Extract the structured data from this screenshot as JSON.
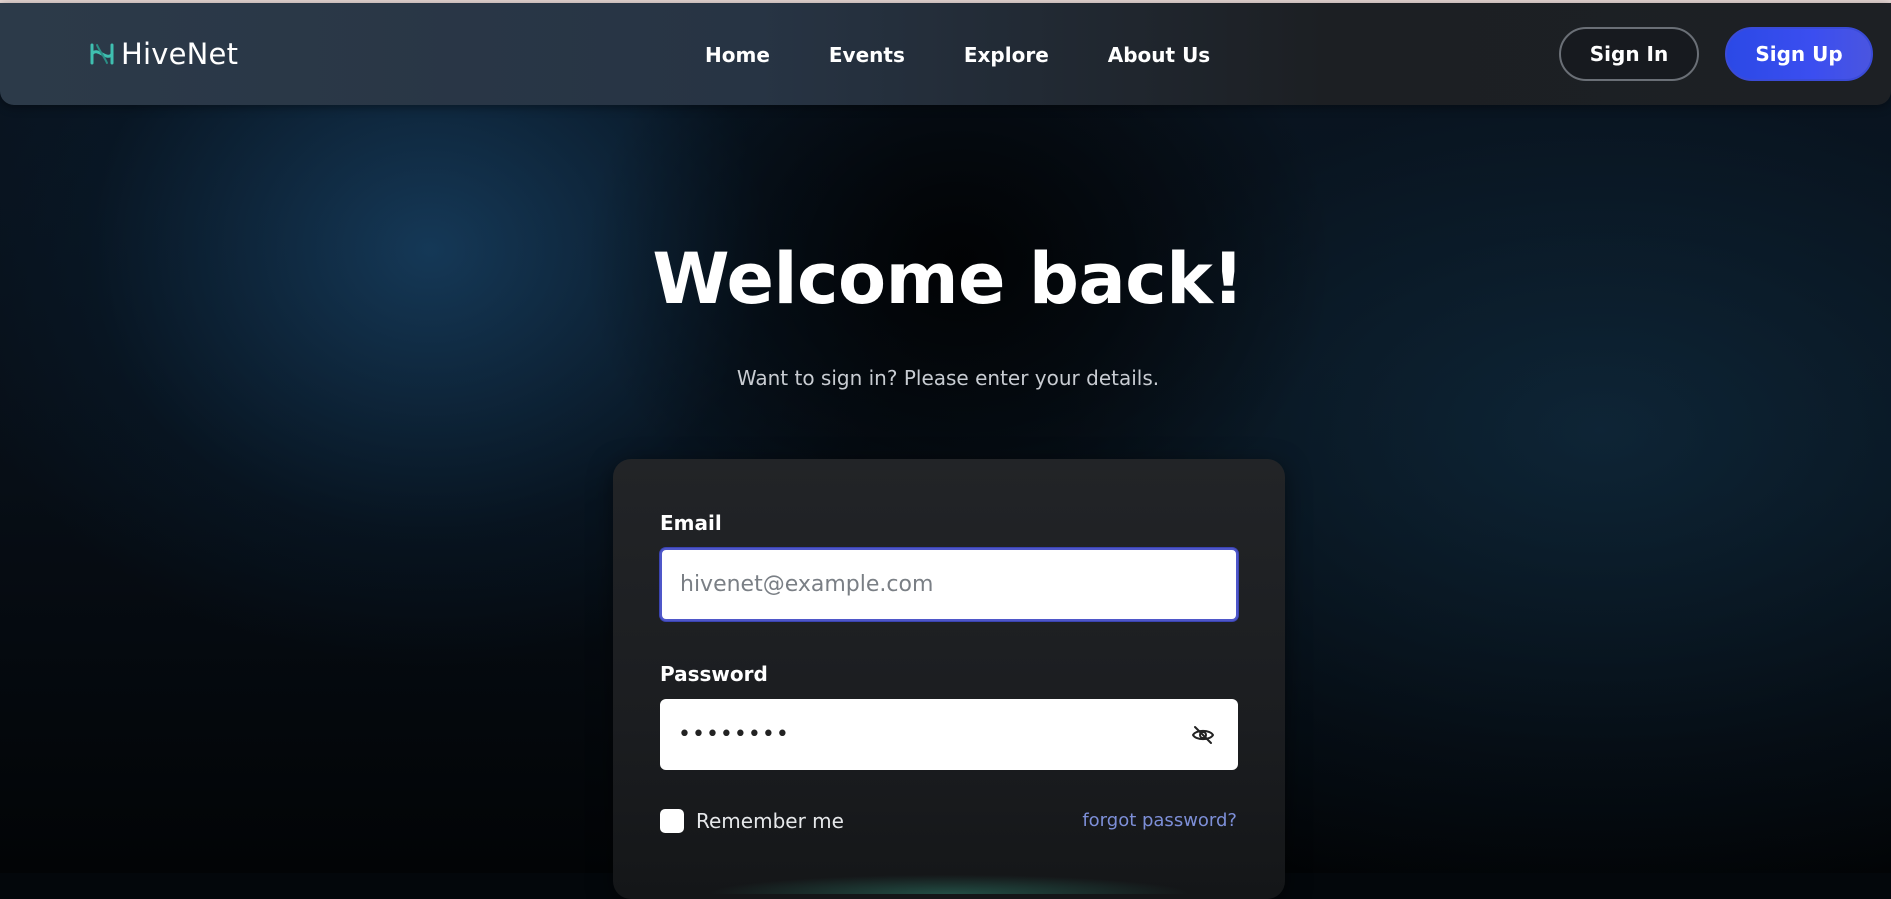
{
  "brand": {
    "name": "HiveNet",
    "icon": "hivenet-logo-icon",
    "accent_color": "#3fbfb0"
  },
  "nav": {
    "items": [
      {
        "label": "Home"
      },
      {
        "label": "Events"
      },
      {
        "label": "Explore"
      },
      {
        "label": "About Us"
      }
    ],
    "sign_in_label": "Sign In",
    "sign_up_label": "Sign Up",
    "sign_up_color": "#3349e6"
  },
  "hero": {
    "title": "Welcome back!",
    "subtitle": "Want to sign in? Please enter your details."
  },
  "form": {
    "email_label": "Email",
    "email_placeholder": "hivenet@example.com",
    "email_value": "",
    "password_label": "Password",
    "password_value": "••••••••",
    "password_toggle_icon": "eye-off-icon",
    "remember_label": "Remember me",
    "remember_checked": false,
    "forgot_label": "forgot password?"
  }
}
